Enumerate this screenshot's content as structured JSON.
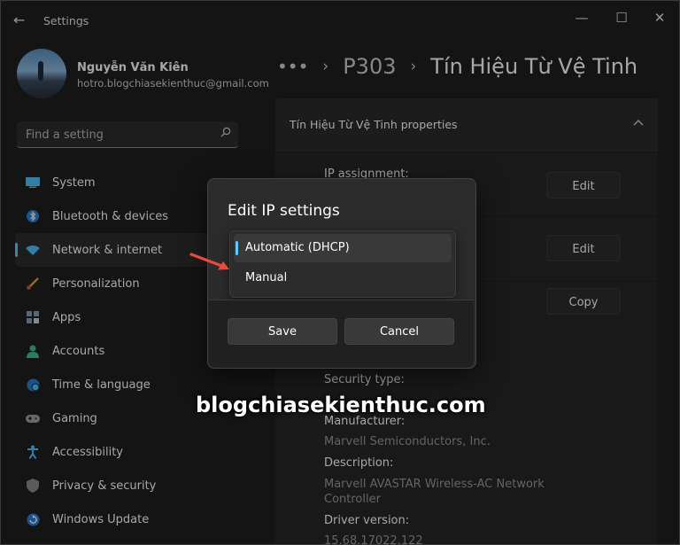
{
  "window": {
    "title": "Settings",
    "controls": [
      "—",
      "☐",
      "✕"
    ],
    "back_icon": "arrow-left-icon"
  },
  "user": {
    "name": "Nguyễn Văn Kiên",
    "email": "hotro.blogchiasekienthuc@gmail.com"
  },
  "search": {
    "placeholder": "Find a setting",
    "icon": "search-icon"
  },
  "sidebar": {
    "items": [
      {
        "label": "System",
        "icon": "monitor-icon",
        "color": "#4cc2ff"
      },
      {
        "label": "Bluetooth & devices",
        "icon": "bluetooth-icon",
        "color": "#4cc2ff"
      },
      {
        "label": "Network & internet",
        "icon": "wifi-icon",
        "color": "#4cc2ff",
        "active": true
      },
      {
        "label": "Personalization",
        "icon": "brush-icon",
        "color": "#e8a33a"
      },
      {
        "label": "Apps",
        "icon": "apps-icon",
        "color": "#8a9bb5"
      },
      {
        "label": "Accounts",
        "icon": "person-icon",
        "color": "#3cc29a"
      },
      {
        "label": "Time & language",
        "icon": "globe-clock-icon",
        "color": "#4cc2ff"
      },
      {
        "label": "Gaming",
        "icon": "gamepad-icon",
        "color": "#a0a0a0"
      },
      {
        "label": "Accessibility",
        "icon": "accessibility-icon",
        "color": "#4cc2ff"
      },
      {
        "label": "Privacy & security",
        "icon": "shield-icon",
        "color": "#8a8a8a"
      },
      {
        "label": "Windows Update",
        "icon": "update-icon",
        "color": "#4cc2ff"
      }
    ]
  },
  "breadcrumb": {
    "dots": "•••",
    "items": [
      "P303",
      "Tín Hiệu Từ Vệ Tinh"
    ]
  },
  "properties": {
    "header": "Tín Hiệu Từ Vệ Tinh properties",
    "ip_assignment_label": "IP assignment:",
    "edit_label": "Edit",
    "copy_label": "Copy",
    "security_type_label": "Security type:",
    "manufacturer_label": "Manufacturer:",
    "manufacturer_value": "Marvell Semiconductors, Inc.",
    "description_label": "Description:",
    "description_value_line1": "Marvell AVASTAR Wireless-AC Network",
    "description_value_line2": "Controller",
    "driver_version_label": "Driver version:",
    "driver_version_value": "15.68.17022.122"
  },
  "dialog": {
    "title": "Edit IP settings",
    "options": [
      "Automatic (DHCP)",
      "Manual"
    ],
    "selected": "Automatic (DHCP)",
    "save_label": "Save",
    "cancel_label": "Cancel"
  },
  "watermark": "blogchiasekienthuc.com",
  "colors": {
    "accent": "#60cdff",
    "arrow": "#e84a3c"
  }
}
